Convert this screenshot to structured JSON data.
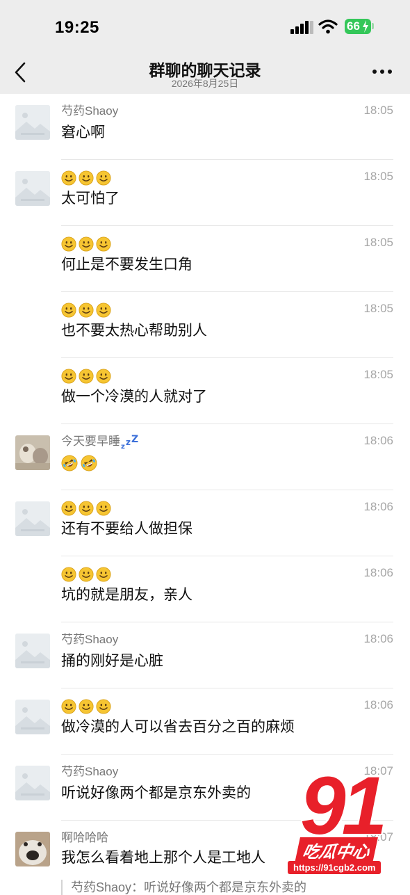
{
  "status_bar": {
    "time": "19:25",
    "battery": "66"
  },
  "header": {
    "title": "群聊的聊天记录",
    "subtitle": "2026年8月25日"
  },
  "icons": {
    "back": "chevron-left-icon",
    "more": "more-dots-icon",
    "smile": "smile-emoji-icon",
    "rofl": "rofl-emoji-icon",
    "zzz": "zzz-emoji-icon"
  },
  "colors": {
    "header_bg": "#ededed",
    "battery": "#34c759",
    "watermark": "#e8202a"
  },
  "messages": [
    {
      "sender": "芍药Shaoy",
      "time": "18:05",
      "text": "窘心啊"
    },
    {
      "sender": "",
      "time": "18:05",
      "text": "太可怕了"
    },
    {
      "sender": "",
      "time": "18:05",
      "text": "何止是不要发生口角"
    },
    {
      "sender": "",
      "time": "18:05",
      "text": "也不要太热心帮助别人"
    },
    {
      "sender": "",
      "time": "18:05",
      "text": "做一个冷漠的人就对了"
    },
    {
      "sender": "今天要早睡",
      "time": "18:06",
      "text": ""
    },
    {
      "sender": "",
      "time": "18:06",
      "text": "还有不要给人做担保"
    },
    {
      "sender": "",
      "time": "18:06",
      "text": "坑的就是朋友，亲人"
    },
    {
      "sender": "芍药Shaoy",
      "time": "18:06",
      "text": "捅的刚好是心脏"
    },
    {
      "sender": "",
      "time": "18:06",
      "text": "做冷漠的人可以省去百分之百的麻烦"
    },
    {
      "sender": "芍药Shaoy",
      "time": "18:07",
      "text": "听说好像两个都是京东外卖的"
    },
    {
      "sender": "啊哈哈哈",
      "time": "18:07",
      "text": "我怎么看着地上那个人是工地人",
      "quote": "芍药Shaoy：听说好像两个都是京东外卖的"
    }
  ],
  "watermark": {
    "number": "91",
    "name": "吃瓜中心",
    "url": "https://91cgb2.com"
  }
}
